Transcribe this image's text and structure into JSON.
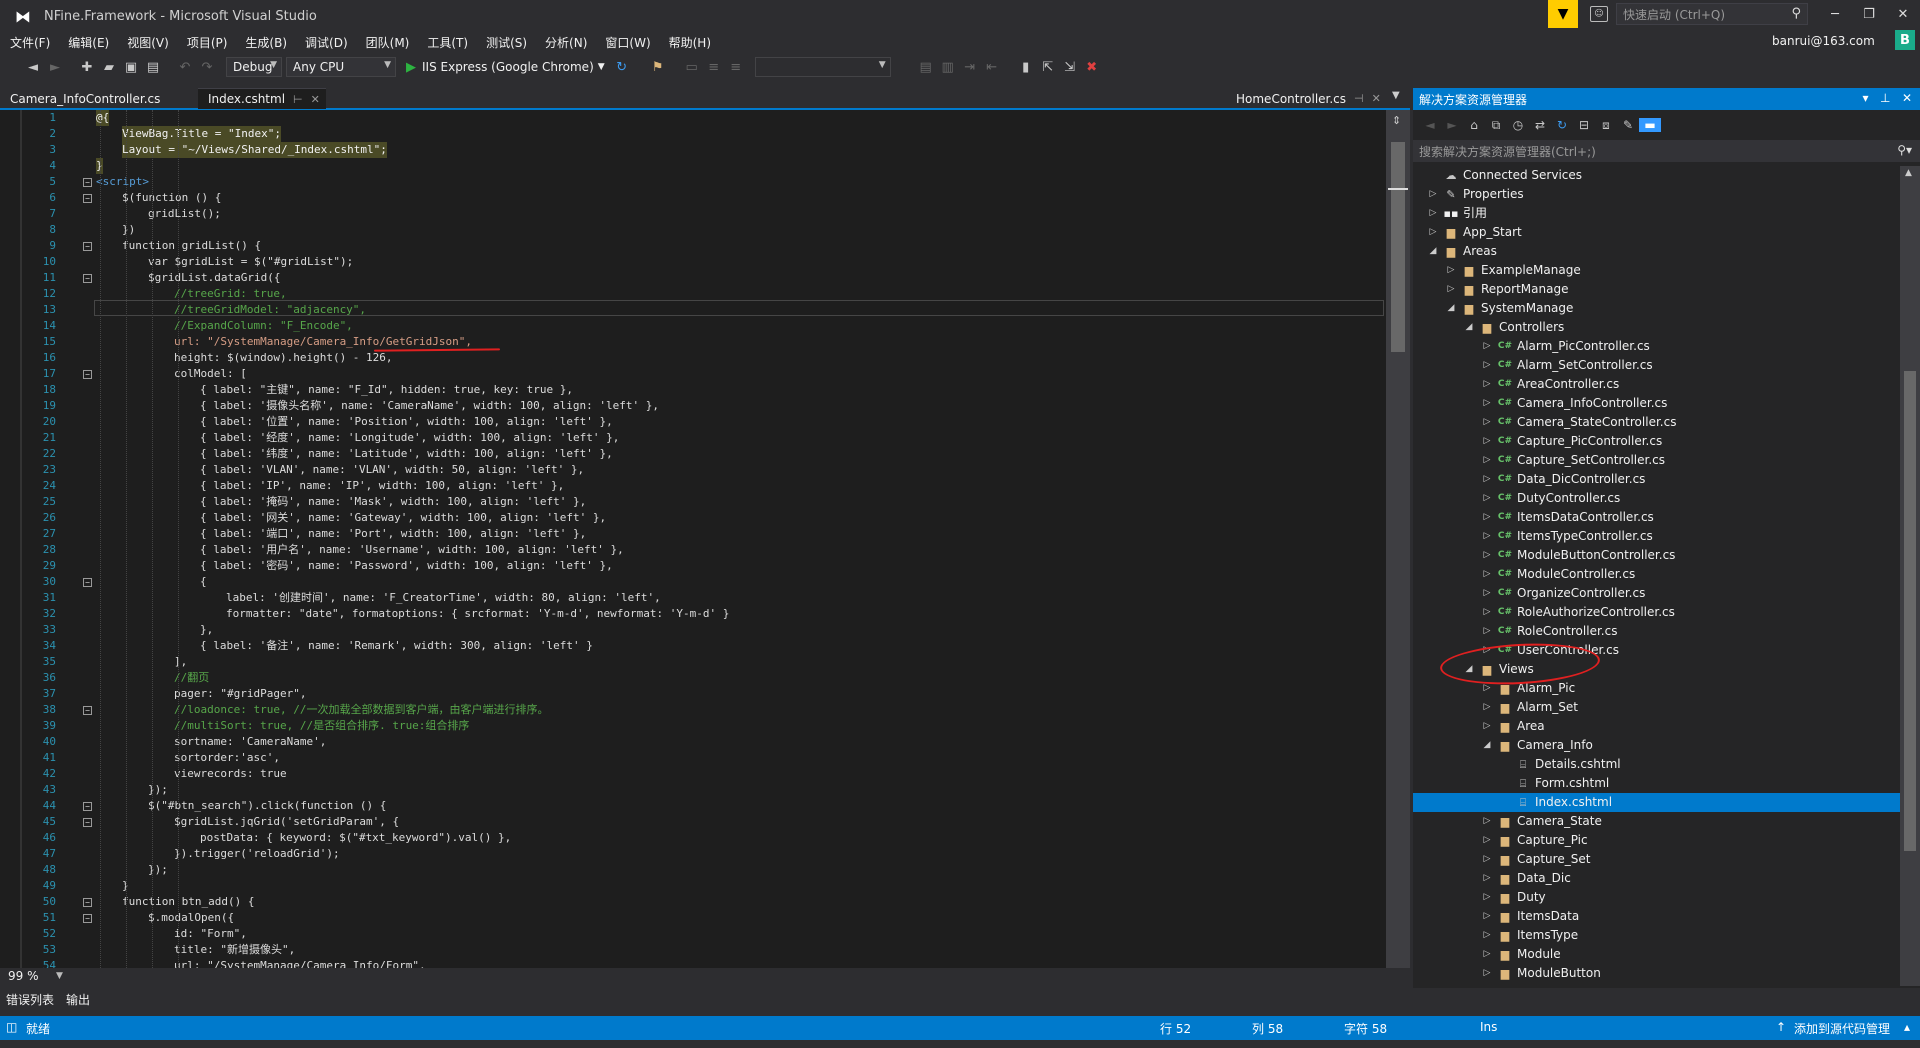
{
  "window": {
    "title": "NFine.Framework - Microsoft Visual Studio",
    "quick_launch_placeholder": "快速启动 (Ctrl+Q)",
    "user": "banrui@163.com",
    "avatar_letter": "B"
  },
  "menu": [
    "文件(F)",
    "编辑(E)",
    "视图(V)",
    "项目(P)",
    "生成(B)",
    "调试(D)",
    "团队(M)",
    "工具(T)",
    "测试(S)",
    "分析(N)",
    "窗口(W)",
    "帮助(H)"
  ],
  "toolbar": {
    "config": "Debug",
    "platform": "Any CPU",
    "run": "IIS Express (Google Chrome)"
  },
  "tabs": [
    {
      "label": "Camera_InfoController.cs",
      "active": false
    },
    {
      "label": "Index.cshtml",
      "active": true
    },
    {
      "label": "HomeController.cs",
      "active": false
    }
  ],
  "editor": {
    "zoom": "99 %",
    "lines": [
      {
        "n": "1",
        "t": "@{",
        "k": "hl",
        "i": 0
      },
      {
        "n": "2",
        "t": "ViewBag.Title = \"Index\";",
        "k": "hl",
        "i": 1
      },
      {
        "n": "3",
        "t": "Layout = \"~/Views/Shared/_Index.cshtml\";",
        "k": "hl",
        "i": 1
      },
      {
        "n": "4",
        "t": "}",
        "k": "hl",
        "i": 0
      },
      {
        "n": "5",
        "t": "<script>",
        "k": "kw",
        "i": 0
      },
      {
        "n": "6",
        "t": "$(function () {",
        "k": "tx",
        "i": 1
      },
      {
        "n": "7",
        "t": "gridList();",
        "k": "tx",
        "i": 2
      },
      {
        "n": "8",
        "t": "})",
        "k": "tx",
        "i": 1
      },
      {
        "n": "9",
        "t": "function gridList() {",
        "k": "tx",
        "i": 1
      },
      {
        "n": "10",
        "t": "var $gridList = $(\"#gridList\");",
        "k": "tx",
        "i": 2
      },
      {
        "n": "11",
        "t": "$gridList.dataGrid({",
        "k": "tx",
        "i": 2
      },
      {
        "n": "12",
        "t": "//treeGrid: true,",
        "k": "cm",
        "i": 3
      },
      {
        "n": "13",
        "t": "//treeGridModel: \"adjacency\",",
        "k": "cm",
        "i": 3
      },
      {
        "n": "14",
        "t": "//ExpandColumn: \"F_Encode\",",
        "k": "cm",
        "i": 3
      },
      {
        "n": "15",
        "t": "url: \"/SystemManage/Camera_Info/GetGridJson\",",
        "k": "str",
        "i": 3
      },
      {
        "n": "16",
        "t": "height: $(window).height() - 126,",
        "k": "tx",
        "i": 3
      },
      {
        "n": "17",
        "t": "colModel: [",
        "k": "tx",
        "i": 3
      },
      {
        "n": "18",
        "t": "{ label: \"主键\", name: \"F_Id\", hidden: true, key: true },",
        "k": "tx",
        "i": 4
      },
      {
        "n": "19",
        "t": "{ label: '摄像头名称', name: 'CameraName', width: 100, align: 'left' },",
        "k": "tx",
        "i": 4
      },
      {
        "n": "20",
        "t": "{ label: '位置', name: 'Position', width: 100, align: 'left' },",
        "k": "tx",
        "i": 4
      },
      {
        "n": "21",
        "t": "{ label: '经度', name: 'Longitude', width: 100, align: 'left' },",
        "k": "tx",
        "i": 4
      },
      {
        "n": "22",
        "t": "{ label: '纬度', name: 'Latitude', width: 100, align: 'left' },",
        "k": "tx",
        "i": 4
      },
      {
        "n": "23",
        "t": "{ label: 'VLAN', name: 'VLAN', width: 50, align: 'left' },",
        "k": "tx",
        "i": 4
      },
      {
        "n": "24",
        "t": "{ label: 'IP', name: 'IP', width: 100, align: 'left' },",
        "k": "tx",
        "i": 4
      },
      {
        "n": "25",
        "t": "{ label: '掩码', name: 'Mask', width: 100, align: 'left' },",
        "k": "tx",
        "i": 4
      },
      {
        "n": "26",
        "t": "{ label: '网关', name: 'Gateway', width: 100, align: 'left' },",
        "k": "tx",
        "i": 4
      },
      {
        "n": "27",
        "t": "{ label: '端口', name: 'Port', width: 100, align: 'left' },",
        "k": "tx",
        "i": 4
      },
      {
        "n": "28",
        "t": "{ label: '用户名', name: 'Username', width: 100, align: 'left' },",
        "k": "tx",
        "i": 4
      },
      {
        "n": "29",
        "t": "{ label: '密码', name: 'Password', width: 100, align: 'left' },",
        "k": "tx",
        "i": 4
      },
      {
        "n": "30",
        "t": "{",
        "k": "tx",
        "i": 4
      },
      {
        "n": "31",
        "t": "label: '创建时间', name: 'F_CreatorTime', width: 80, align: 'left',",
        "k": "tx",
        "i": 5
      },
      {
        "n": "32",
        "t": "formatter: \"date\", formatoptions: { srcformat: 'Y-m-d', newformat: 'Y-m-d' }",
        "k": "tx",
        "i": 5
      },
      {
        "n": "33",
        "t": "},",
        "k": "tx",
        "i": 4
      },
      {
        "n": "34",
        "t": "{ label: '备注', name: 'Remark', width: 300, align: 'left' }",
        "k": "tx",
        "i": 4
      },
      {
        "n": "35",
        "t": "],",
        "k": "tx",
        "i": 3
      },
      {
        "n": "36",
        "t": "//翻页",
        "k": "cm",
        "i": 3
      },
      {
        "n": "37",
        "t": "pager: \"#gridPager\",",
        "k": "tx",
        "i": 3
      },
      {
        "n": "38",
        "t": "//loadonce: true, //一次加载全部数据到客户端，由客户端进行排序。",
        "k": "cm",
        "i": 3
      },
      {
        "n": "39",
        "t": "//multiSort: true, //是否组合排序. true:组合排序",
        "k": "cm",
        "i": 3
      },
      {
        "n": "40",
        "t": "sortname: 'CameraName',",
        "k": "tx",
        "i": 3
      },
      {
        "n": "41",
        "t": "sortorder:'asc',",
        "k": "tx",
        "i": 3
      },
      {
        "n": "42",
        "t": "viewrecords: true",
        "k": "tx",
        "i": 3
      },
      {
        "n": "43",
        "t": "});",
        "k": "tx",
        "i": 2
      },
      {
        "n": "44",
        "t": "$(\"#btn_search\").click(function () {",
        "k": "tx",
        "i": 2
      },
      {
        "n": "45",
        "t": "$gridList.jqGrid('setGridParam', {",
        "k": "tx",
        "i": 3
      },
      {
        "n": "46",
        "t": "postData: { keyword: $(\"#txt_keyword\").val() },",
        "k": "tx",
        "i": 4
      },
      {
        "n": "47",
        "t": "}).trigger('reloadGrid');",
        "k": "tx",
        "i": 3
      },
      {
        "n": "48",
        "t": "});",
        "k": "tx",
        "i": 2
      },
      {
        "n": "49",
        "t": "}",
        "k": "tx",
        "i": 1
      },
      {
        "n": "50",
        "t": "function btn_add() {",
        "k": "tx",
        "i": 1
      },
      {
        "n": "51",
        "t": "$.modalOpen({",
        "k": "tx",
        "i": 2
      },
      {
        "n": "52",
        "t": "id: \"Form\",",
        "k": "tx",
        "i": 3
      },
      {
        "n": "53",
        "t": "title: \"新增摄像头\",",
        "k": "tx",
        "i": 3
      },
      {
        "n": "54",
        "t": "url: \"/SystemManage/Camera_Info/Form\",",
        "k": "tx",
        "i": 3
      }
    ],
    "fold_lines": [
      "5",
      "6",
      "9",
      "11",
      "17",
      "30",
      "38",
      "44",
      "45",
      "50",
      "51"
    ]
  },
  "solution_explorer": {
    "title": "解决方案资源管理器",
    "search_placeholder": "搜索解决方案资源管理器(Ctrl+;)",
    "items": [
      {
        "label": "Connected Services",
        "lvl": 3,
        "icon": "cloud",
        "tw": ""
      },
      {
        "label": "Properties",
        "lvl": 3,
        "icon": "wrench",
        "tw": "▷"
      },
      {
        "label": "引用",
        "lvl": 3,
        "icon": "refs",
        "tw": "▷"
      },
      {
        "label": "App_Start",
        "lvl": 3,
        "icon": "folder",
        "tw": "▷"
      },
      {
        "label": "Areas",
        "lvl": 3,
        "icon": "folder",
        "tw": "◢"
      },
      {
        "label": "ExampleManage",
        "lvl": 4,
        "icon": "folder",
        "tw": "▷"
      },
      {
        "label": "ReportManage",
        "lvl": 4,
        "icon": "folder",
        "tw": "▷"
      },
      {
        "label": "SystemManage",
        "lvl": 4,
        "icon": "folder",
        "tw": "◢"
      },
      {
        "label": "Controllers",
        "lvl": 5,
        "icon": "folder",
        "tw": "◢"
      },
      {
        "label": "Alarm_PicController.cs",
        "lvl": 6,
        "icon": "cs",
        "tw": "▷"
      },
      {
        "label": "Alarm_SetController.cs",
        "lvl": 6,
        "icon": "cs",
        "tw": "▷"
      },
      {
        "label": "AreaController.cs",
        "lvl": 6,
        "icon": "cs",
        "tw": "▷"
      },
      {
        "label": "Camera_InfoController.cs",
        "lvl": 6,
        "icon": "cs",
        "tw": "▷"
      },
      {
        "label": "Camera_StateController.cs",
        "lvl": 6,
        "icon": "cs",
        "tw": "▷"
      },
      {
        "label": "Capture_PicController.cs",
        "lvl": 6,
        "icon": "cs",
        "tw": "▷"
      },
      {
        "label": "Capture_SetController.cs",
        "lvl": 6,
        "icon": "cs",
        "tw": "▷"
      },
      {
        "label": "Data_DicController.cs",
        "lvl": 6,
        "icon": "cs",
        "tw": "▷"
      },
      {
        "label": "DutyController.cs",
        "lvl": 6,
        "icon": "cs",
        "tw": "▷"
      },
      {
        "label": "ItemsDataController.cs",
        "lvl": 6,
        "icon": "cs",
        "tw": "▷"
      },
      {
        "label": "ItemsTypeController.cs",
        "lvl": 6,
        "icon": "cs",
        "tw": "▷"
      },
      {
        "label": "ModuleButtonController.cs",
        "lvl": 6,
        "icon": "cs",
        "tw": "▷"
      },
      {
        "label": "ModuleController.cs",
        "lvl": 6,
        "icon": "cs",
        "tw": "▷"
      },
      {
        "label": "OrganizeController.cs",
        "lvl": 6,
        "icon": "cs",
        "tw": "▷"
      },
      {
        "label": "RoleAuthorizeController.cs",
        "lvl": 6,
        "icon": "cs",
        "tw": "▷"
      },
      {
        "label": "RoleController.cs",
        "lvl": 6,
        "icon": "cs",
        "tw": "▷"
      },
      {
        "label": "UserController.cs",
        "lvl": 6,
        "icon": "cs",
        "tw": "▷"
      },
      {
        "label": "Views",
        "lvl": 5,
        "icon": "folder",
        "tw": "◢"
      },
      {
        "label": "Alarm_Pic",
        "lvl": 6,
        "icon": "folder",
        "tw": "▷"
      },
      {
        "label": "Alarm_Set",
        "lvl": 6,
        "icon": "folder",
        "tw": "▷"
      },
      {
        "label": "Area",
        "lvl": 6,
        "icon": "folder",
        "tw": "▷"
      },
      {
        "label": "Camera_Info",
        "lvl": 6,
        "icon": "folder",
        "tw": "◢"
      },
      {
        "label": "Details.cshtml",
        "lvl": 7,
        "icon": "page",
        "tw": ""
      },
      {
        "label": "Form.cshtml",
        "lvl": 7,
        "icon": "page",
        "tw": ""
      },
      {
        "label": "Index.cshtml",
        "lvl": 7,
        "icon": "page",
        "tw": "",
        "selected": true
      },
      {
        "label": "Camera_State",
        "lvl": 6,
        "icon": "folder",
        "tw": "▷"
      },
      {
        "label": "Capture_Pic",
        "lvl": 6,
        "icon": "folder",
        "tw": "▷"
      },
      {
        "label": "Capture_Set",
        "lvl": 6,
        "icon": "folder",
        "tw": "▷"
      },
      {
        "label": "Data_Dic",
        "lvl": 6,
        "icon": "folder",
        "tw": "▷"
      },
      {
        "label": "Duty",
        "lvl": 6,
        "icon": "folder",
        "tw": "▷"
      },
      {
        "label": "ItemsData",
        "lvl": 6,
        "icon": "folder",
        "tw": "▷"
      },
      {
        "label": "ItemsType",
        "lvl": 6,
        "icon": "folder",
        "tw": "▷"
      },
      {
        "label": "Module",
        "lvl": 6,
        "icon": "folder",
        "tw": "▷"
      },
      {
        "label": "ModuleButton",
        "lvl": 6,
        "icon": "folder",
        "tw": "▷"
      }
    ]
  },
  "bottom_tabs": [
    "错误列表",
    "输出"
  ],
  "status": {
    "ready": "就绪",
    "line": "行 52",
    "col": "列 58",
    "ch": "字符 58",
    "ins": "Ins",
    "source_control": "添加到源代码管理"
  },
  "colors": {
    "accent": "#007acc",
    "editor_bg": "#1e1e1e",
    "string": "#d69d85",
    "keyword": "#569cd6",
    "comment": "#57a64a",
    "annotation": "#e02020"
  }
}
